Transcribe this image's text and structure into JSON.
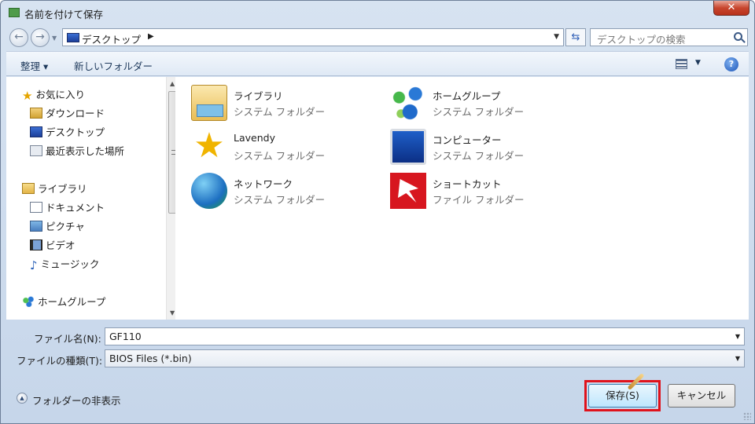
{
  "window": {
    "title": "名前を付けて保存",
    "close_label": "✕"
  },
  "address": {
    "location": "デスクトップ",
    "search_placeholder": "デスクトップの検索"
  },
  "toolbar": {
    "organize_label": "整理 ▾",
    "new_folder_label": "新しいフォルダー",
    "help_label": "?"
  },
  "nav": {
    "favorites": [
      {
        "label": "お気に入り",
        "icon": "star-icon"
      },
      {
        "label": "ダウンロード",
        "icon": "downloads-folder-icon"
      },
      {
        "label": "デスクトップ",
        "icon": "desktop-icon"
      },
      {
        "label": "最近表示した場所",
        "icon": "recent-places-icon"
      }
    ],
    "libraries": [
      {
        "label": "ライブラリ",
        "icon": "library-icon"
      },
      {
        "label": "ドキュメント",
        "icon": "document-icon"
      },
      {
        "label": "ピクチャ",
        "icon": "pictures-icon"
      },
      {
        "label": "ビデオ",
        "icon": "video-icon"
      },
      {
        "label": "ミュージック",
        "icon": "music-icon"
      }
    ],
    "homegroup": {
      "label": "ホームグループ",
      "icon": "homegroup-icon"
    }
  },
  "items": [
    {
      "name": "ライブラリ",
      "kind": "システム フォルダー",
      "icon": "library-icon"
    },
    {
      "name": "ホームグループ",
      "kind": "システム フォルダー",
      "icon": "homegroup-icon"
    },
    {
      "name": "Lavendy",
      "kind": "システム フォルダー",
      "icon": "user-folder-star-icon"
    },
    {
      "name": "コンピューター",
      "kind": "システム フォルダー",
      "icon": "computer-icon"
    },
    {
      "name": "ネットワーク",
      "kind": "システム フォルダー",
      "icon": "network-icon"
    },
    {
      "name": "ショートカット",
      "kind": "ファイル フォルダー",
      "icon": "shortcut-folder-icon"
    }
  ],
  "form": {
    "filename_label": "ファイル名(N):",
    "filename_value": "GF110",
    "filetype_label": "ファイルの種類(T):",
    "filetype_value": "BIOS Files (*.bin)"
  },
  "footer": {
    "hide_folders_label": "フォルダーの非表示",
    "save_label": "保存(S)",
    "cancel_label": "キャンセル"
  },
  "colors": {
    "highlight": "#e0121b",
    "window_frame": "#c6d6ea"
  }
}
